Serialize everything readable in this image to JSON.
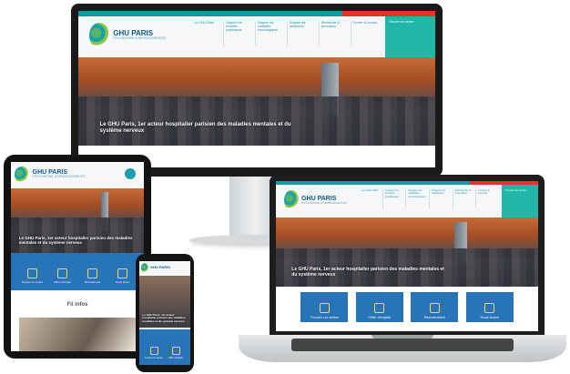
{
  "site": {
    "brand_main": "GHU PARIS",
    "brand_sub": "PSYCHIATRIE & NEUROSCIENCES",
    "nav": [
      "Le GHU Paris",
      "Soigner les troubles psychiques",
      "Soigner les maladies neurologiques",
      "Soigner les addictions",
      "Recherche & innovation",
      "Former & innover"
    ],
    "cta": "Trouver un centre",
    "hero_caption": "Le GHU Paris, 1er acteur hospitalier parisien des maladies mentales et du système nerveux",
    "hero_caption_mobile": "Le GHU Paris, 1er acteur hospitalier parisien des maladies mentales et du système nerveux",
    "tiles": [
      "Trouver un centre",
      "Offre d'emploi",
      "Recrutement",
      "Nous écrire"
    ],
    "fil_infos": "Fil infos"
  },
  "colors": {
    "teal": "#0f9aa4",
    "urgent_red": "#e3332c",
    "tile_blue": "#2774b8",
    "brand_blue": "#0d5c8e"
  }
}
